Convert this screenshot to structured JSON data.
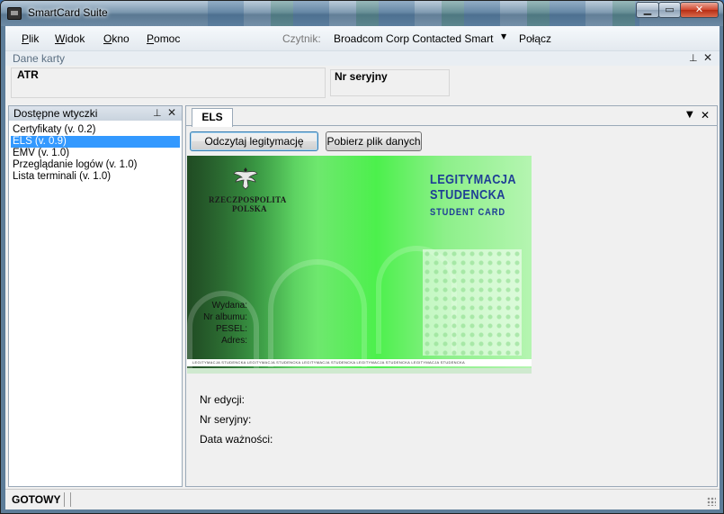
{
  "window": {
    "title": "SmartCard Suite"
  },
  "menu": {
    "items": [
      "Plik",
      "Widok",
      "Okno",
      "Pomoc"
    ],
    "reader_label": "Czytnik:",
    "reader_value": "Broadcom Corp Contacted Smart",
    "connect_label": "Połącz"
  },
  "card_data_panel": {
    "title": "Dane karty",
    "atr_label": "ATR",
    "serial_label": "Nr seryjny"
  },
  "plugins_panel": {
    "title": "Dostępne wtyczki",
    "items": [
      "Certyfikaty (v. 0.2)",
      "ELS (v. 0.9)",
      "EMV (v. 1.0)",
      "Przeglądanie logów (v. 1.0)",
      "Lista terminali (v. 1.0)"
    ],
    "selected_index": 1
  },
  "document": {
    "tab_label": "ELS",
    "read_button": "Odczytaj legitymację",
    "fetch_button": "Pobierz plik danych",
    "card_image": {
      "country_line1": "RZECZPOSPOLITA",
      "country_line2": "POLSKA",
      "title_line1": "LEGITYMACJA",
      "title_line2": "STUDENCKA",
      "title_line3": "STUDENT CARD",
      "fields": [
        "Wydana:",
        "Nr albumu:",
        "PESEL:",
        "Adres:"
      ],
      "stripe_text": "LEGITYMACJA STUDENCKA    LEGITYMACJA STUDENCKA    LEGITYMACJA STUDENCKA    LEGITYMACJA STUDENCKA    LEGITYMACJA STUDENCKA"
    },
    "info_labels": [
      "Nr edycji:",
      "Nr seryjny:",
      "Data ważności:"
    ]
  },
  "status": {
    "text": "GOTOWY"
  },
  "colors": {
    "selection": "#3399ff",
    "card_title": "#1f3f95",
    "close_button": "#c8432a"
  },
  "icons": {
    "minimize": "minimize-icon",
    "maximize": "maximize-icon",
    "close": "close-icon",
    "pin": "pin-icon",
    "dropdown": "chevron-down-icon"
  }
}
